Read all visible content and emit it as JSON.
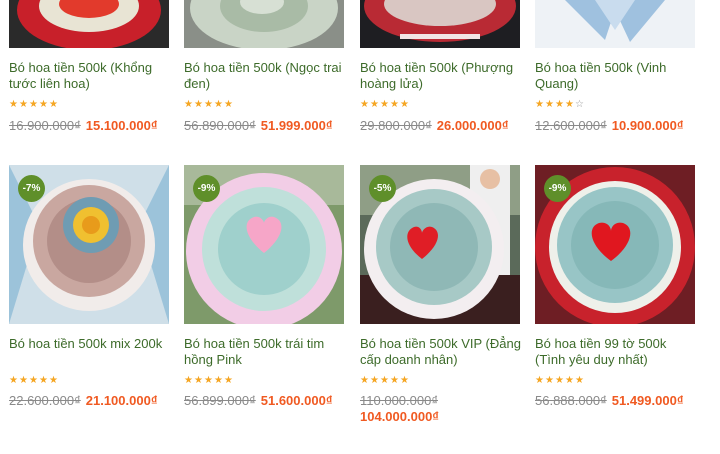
{
  "colors": {
    "title": "#3d6b2a",
    "sale_price": "#f05a22",
    "old_price": "#8a8a8a",
    "badge": "#5f8f2a",
    "star": "#f5a623"
  },
  "products": [
    {
      "name": "Bó hoa tiền 500k (Khổng tước liên hoa)",
      "rating": 5,
      "old_price": "16.900.000₫",
      "new_price": "15.100.000₫",
      "badge": ""
    },
    {
      "name": "Bó hoa tiền 500k (Ngọc trai đen)",
      "rating": 5,
      "old_price": "56.890.000₫",
      "new_price": "51.999.000₫",
      "badge": ""
    },
    {
      "name": "Bó hoa tiền 500k (Phượng hoàng lửa)",
      "rating": 5,
      "old_price": "29.800.000₫",
      "new_price": "26.000.000₫",
      "badge": ""
    },
    {
      "name": "Bó hoa tiền 500k (Vinh Quang)",
      "rating": 4,
      "old_price": "12.600.000₫",
      "new_price": "10.900.000₫",
      "badge": ""
    },
    {
      "name": "Bó hoa tiền 500k mix 200k",
      "rating": 5,
      "old_price": "22.600.000₫",
      "new_price": "21.100.000₫",
      "badge": "-7%"
    },
    {
      "name": "Bó hoa tiền 500k trái tim hồng Pink",
      "rating": 5,
      "old_price": "56.899.000₫",
      "new_price": "51.600.000₫",
      "badge": "-9%"
    },
    {
      "name": "Bó hoa tiền 500k VIP (Đẳng cấp doanh nhân)",
      "rating": 5,
      "old_price": "110.000.000₫",
      "new_price": "104.000.000₫",
      "badge": "-5%"
    },
    {
      "name": "Bó hoa tiền 99 tờ 500k (Tình yêu duy nhất)",
      "rating": 5,
      "old_price": "56.888.000₫",
      "new_price": "51.499.000₫",
      "badge": "-9%"
    }
  ]
}
